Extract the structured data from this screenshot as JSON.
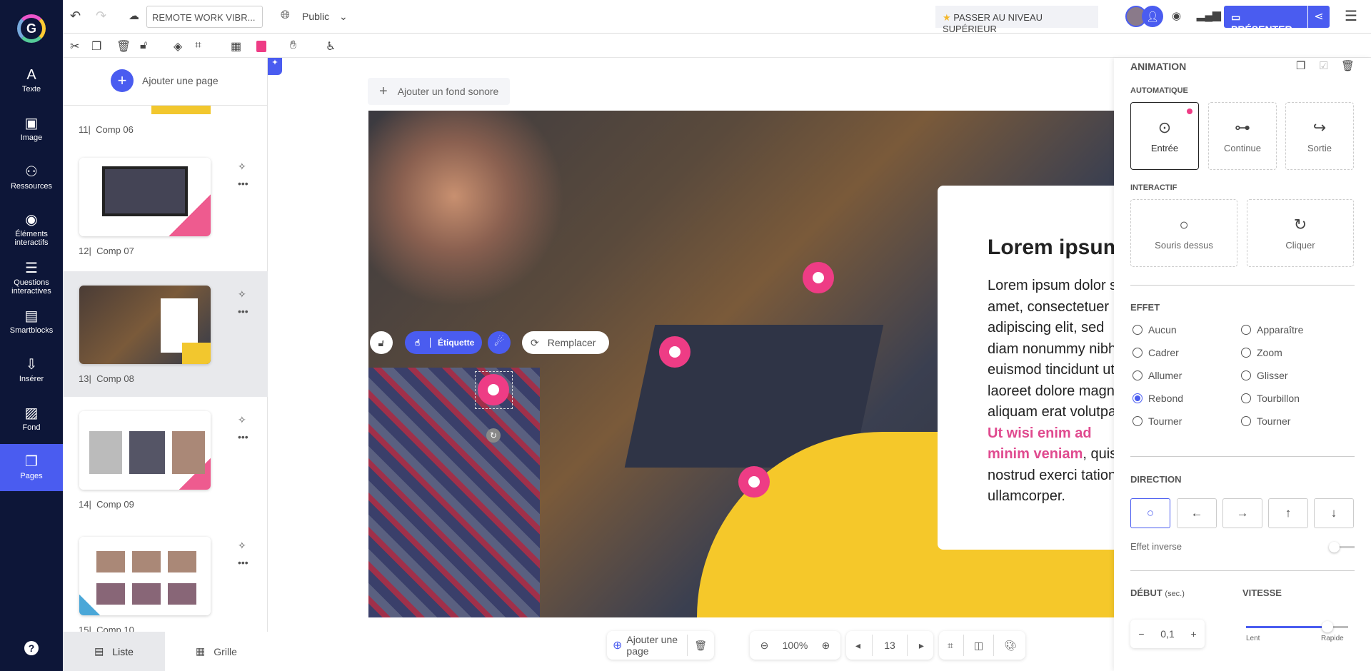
{
  "nav": {
    "items": [
      {
        "label": "Texte",
        "icon": "text-icon"
      },
      {
        "label": "Image",
        "icon": "image-icon"
      },
      {
        "label": "Ressources",
        "icon": "resources-icon"
      },
      {
        "label": "Éléments interactifs",
        "icon": "interactive-icon"
      },
      {
        "label": "Questions interactives",
        "icon": "questions-icon"
      },
      {
        "label": "Smartblocks",
        "icon": "smartblocks-icon"
      },
      {
        "label": "Insérer",
        "icon": "insert-icon"
      },
      {
        "label": "Fond",
        "icon": "background-icon"
      },
      {
        "label": "Pages",
        "icon": "pages-icon",
        "active": true
      }
    ],
    "help": "?"
  },
  "topbar": {
    "title": "REMOTE WORK VIBR...",
    "visibility": "Public",
    "upgrade": "PASSER AU NIVEAU SUPÉRIEUR",
    "present": "PRÉSENTER"
  },
  "toolbar": {
    "color": "#ee3c85"
  },
  "pages": {
    "add": "Ajouter une page",
    "items": [
      {
        "num": "11",
        "name": "Comp 06"
      },
      {
        "num": "12",
        "name": "Comp 07"
      },
      {
        "num": "13",
        "name": "Comp 08",
        "selected": true
      },
      {
        "num": "14",
        "name": "Comp 09"
      },
      {
        "num": "15",
        "name": "Comp 10"
      }
    ],
    "tabs": {
      "list": "Liste",
      "grid": "Grille"
    }
  },
  "canvas": {
    "add_sound": "Ajouter un fond sonore",
    "element_toolbar": {
      "label": "Étiquette",
      "replace": "Remplacer"
    },
    "slide": {
      "title": "Lorem ipsum",
      "body": "Lorem ipsum dolor sit amet, consectetuer adipiscing elit, sed diam nonummy nibh euismod tincidunt ut laoreet dolore magna aliquam erat volutpat.",
      "highlight": "Ut wisi enim ad minim veniam",
      "body2": ", quis nostrud exerci tation ullamcorper.",
      "accent": "#e04a8f"
    }
  },
  "bottombar": {
    "add_page": "Ajouter une page",
    "zoom": "100%",
    "page": "13"
  },
  "panel": {
    "title": "ANIMATION",
    "auto": "AUTOMATIQUE",
    "auto_options": [
      "Entrée",
      "Continue",
      "Sortie"
    ],
    "interactive": "INTERACTIF",
    "interactive_options": [
      "Souris dessus",
      "Cliquer"
    ],
    "effect": "EFFET",
    "effects_left": [
      "Aucun",
      "Cadrer",
      "Allumer",
      "Rebond",
      "Tourner"
    ],
    "effects_right": [
      "Apparaître",
      "Zoom",
      "Glisser",
      "Tourbillon",
      "Tourner"
    ],
    "selected_effect": "Rebond",
    "direction": "DIRECTION",
    "directions": [
      "○",
      "←",
      "→",
      "↑",
      "↓"
    ],
    "inverse": "Effet inverse",
    "inverse_on": false,
    "start": "DÉBUT",
    "start_unit": "(sec.)",
    "start_value": "0,1",
    "speed": "VITESSE",
    "speed_min": "Lent",
    "speed_max": "Rapide",
    "speed_value": 0.8
  }
}
